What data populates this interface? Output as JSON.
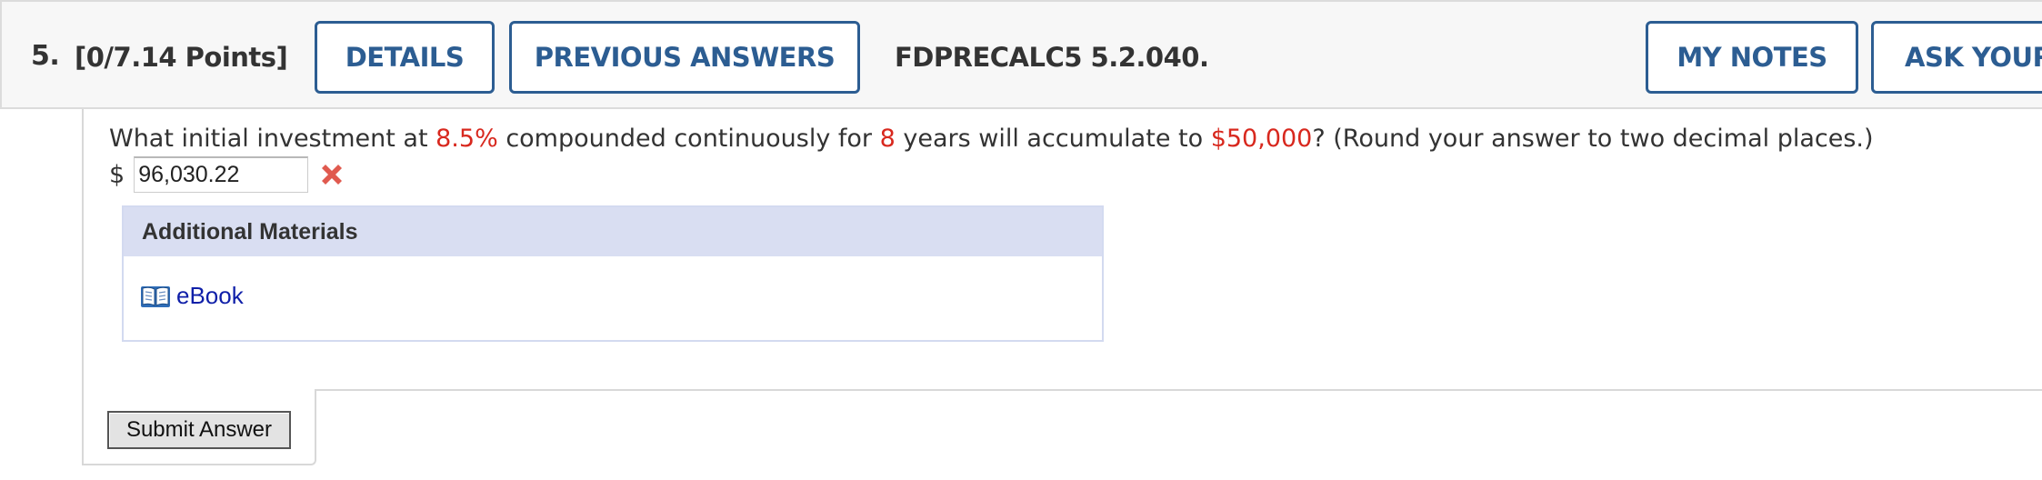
{
  "header": {
    "question_number": "5.",
    "points": "[0/7.14 Points]",
    "details_label": "DETAILS",
    "previous_answers_label": "PREVIOUS ANSWERS",
    "question_code": "FDPRECALC5 5.2.040.",
    "my_notes_label": "MY NOTES",
    "ask_label": "ASK YOUR"
  },
  "question": {
    "part1": "What initial investment at ",
    "rate": "8.5%",
    "part2": " compounded continuously for ",
    "years": "8",
    "part3": " years will accumulate to ",
    "amount": "$50,000",
    "part4": "? (Round your answer to two decimal places.)"
  },
  "answer": {
    "currency_symbol": "$",
    "value": "96,030.22",
    "status_icon": "incorrect-x-icon"
  },
  "materials": {
    "header": "Additional Materials",
    "ebook_label": "eBook",
    "ebook_icon": "book-icon"
  },
  "submit": {
    "label": "Submit Answer"
  },
  "colors": {
    "accent_blue": "#2c5d92",
    "highlight_red": "#d8281e",
    "link_blue": "#0f1fa8",
    "materials_header_bg": "#d9def2",
    "wrong_icon": "#e05a4f"
  }
}
